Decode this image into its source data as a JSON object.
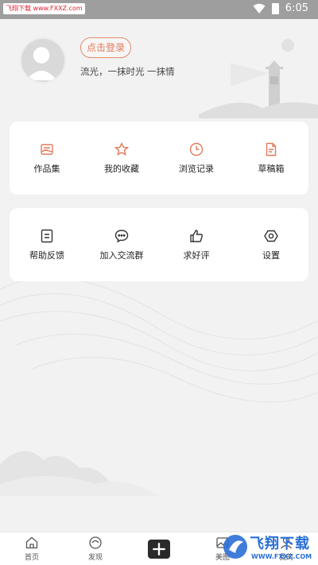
{
  "status_bar": {
    "time": "6:05",
    "watermark": "飞翔下载 www.FXXZ.com"
  },
  "profile": {
    "login_label": "点击登录",
    "slogan": "流光，一抹时光 一抹情"
  },
  "card_1": {
    "items": [
      {
        "label": "作品集",
        "icon": "portfolio-icon"
      },
      {
        "label": "我的收藏",
        "icon": "star-icon"
      },
      {
        "label": "浏览记录",
        "icon": "clock-icon"
      },
      {
        "label": "草稿箱",
        "icon": "draft-icon"
      }
    ]
  },
  "card_2": {
    "items": [
      {
        "label": "帮助反馈",
        "icon": "feedback-icon"
      },
      {
        "label": "加入交流群",
        "icon": "chat-icon"
      },
      {
        "label": "求好评",
        "icon": "thumbs-up-icon"
      },
      {
        "label": "设置",
        "icon": "settings-icon"
      }
    ]
  },
  "bottom_nav": {
    "items": [
      {
        "label": "首页",
        "icon": "home-icon"
      },
      {
        "label": "发现",
        "icon": "discover-icon"
      },
      {
        "label": "",
        "icon": "add-icon"
      },
      {
        "label": "美图",
        "icon": "image-icon"
      },
      {
        "label": "我的",
        "icon": "profile-icon"
      }
    ]
  },
  "watermark_br": {
    "text": "飞翔下载",
    "url": "WWW.FXXZ.COM"
  },
  "colors": {
    "accent": "#e2795b",
    "card_bg": "#ffffff",
    "page_bg": "#f2f2f2"
  }
}
